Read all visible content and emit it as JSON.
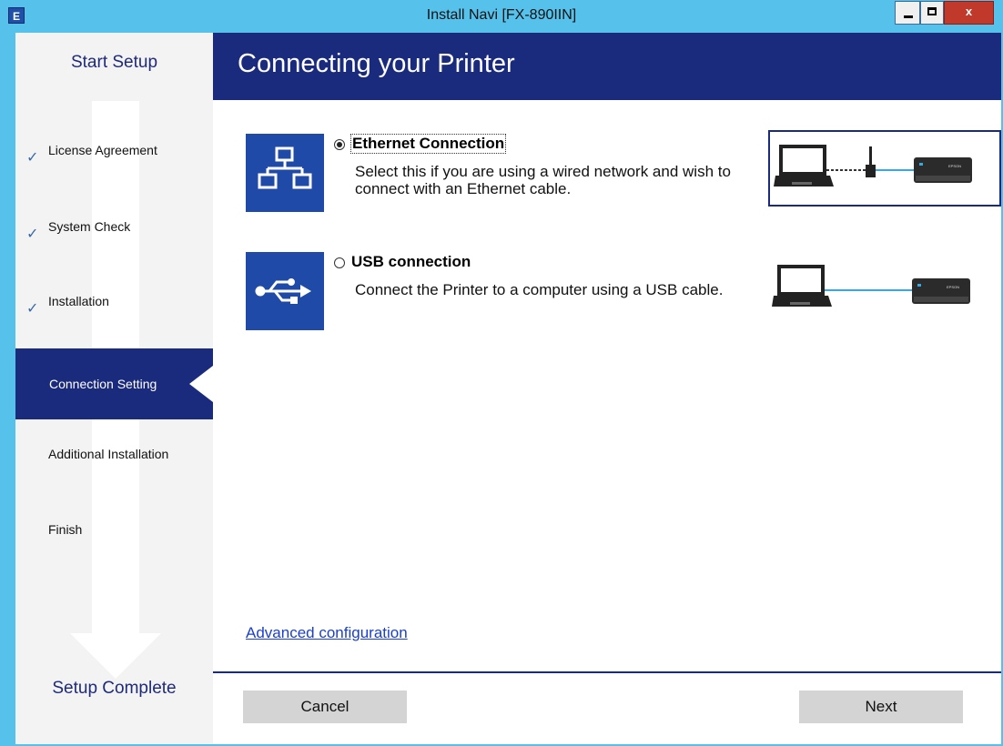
{
  "window": {
    "title": "Install Navi [FX-890IIN]",
    "app_icon_letter": "E",
    "close_label": "x"
  },
  "sidebar": {
    "start_title": "Start Setup",
    "complete_title": "Setup Complete",
    "steps": [
      {
        "label": "License Agreement",
        "completed": true
      },
      {
        "label": "System Check",
        "completed": true
      },
      {
        "label": "Installation",
        "completed": true
      },
      {
        "label": "Connection Setting",
        "active": true
      },
      {
        "label": "Additional Installation"
      },
      {
        "label": "Finish"
      }
    ]
  },
  "header": {
    "title": "Connecting your Printer"
  },
  "options": [
    {
      "title": "Ethernet Connection",
      "description": "Select this if you are using a wired network and wish to connect with an Ethernet cable.",
      "selected": true,
      "icon": "network-icon"
    },
    {
      "title": "USB connection",
      "description": "Connect the Printer to a computer using a USB cable.",
      "selected": false,
      "icon": "usb-icon"
    }
  ],
  "printer_brand": "EPSON",
  "links": {
    "advanced": "Advanced configuration"
  },
  "buttons": {
    "cancel": "Cancel",
    "next": "Next"
  },
  "colors": {
    "accent": "#1a2b7e",
    "icon_blue": "#1f4aa8",
    "titlebar": "#56c2ec",
    "cable": "#3aa7e0",
    "link": "#1a3fd0"
  }
}
